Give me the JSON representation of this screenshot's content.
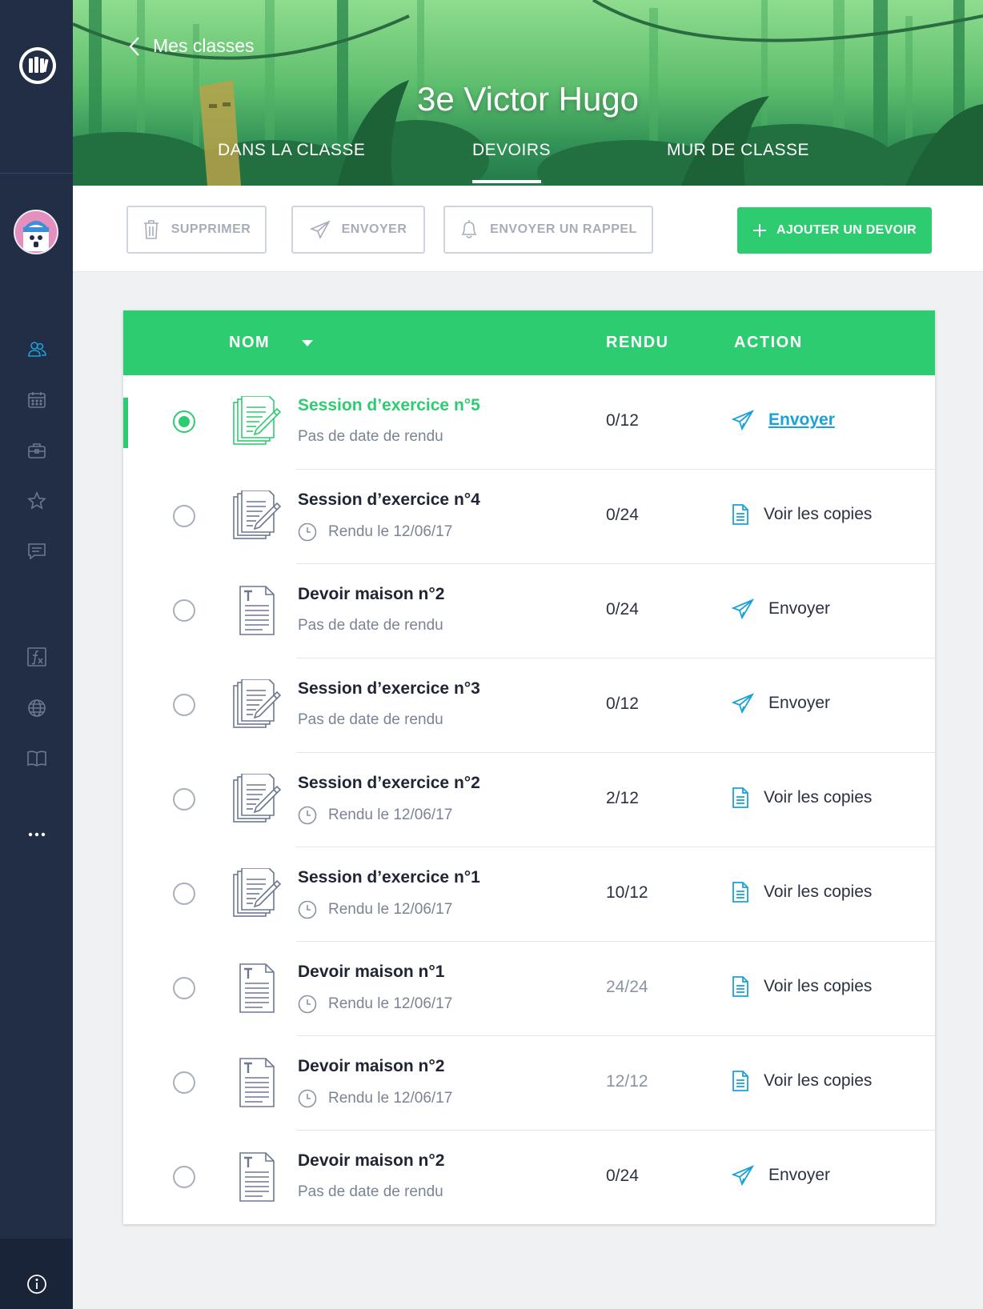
{
  "header": {
    "back_label": "Mes classes",
    "class_title": "3e Victor Hugo",
    "tabs": [
      {
        "label": "DANS LA CLASSE",
        "active": false
      },
      {
        "label": "DEVOIRS",
        "active": true
      },
      {
        "label": "MUR DE CLASSE",
        "active": false
      }
    ]
  },
  "toolbar": {
    "delete_label": "SUPPRIMER",
    "send_label": "ENVOYER",
    "reminder_label": "ENVOYER UN RAPPEL",
    "add_label": "AJOUTER UN DEVOIR"
  },
  "table": {
    "columns": {
      "name": "NOM",
      "rendu": "RENDU",
      "action": "ACTION"
    },
    "rows": [
      {
        "name": "Session d’exercice n°5",
        "sub": "Pas de date de rendu",
        "has_clock": false,
        "rendu": "0/12",
        "rendu_muted": false,
        "action": "Envoyer",
        "action_icon": "paper-plane-icon",
        "file_icon": "exercise-sheet-icon",
        "selected": true
      },
      {
        "name": "Session d’exercice n°4",
        "sub": "Rendu le 12/06/17",
        "has_clock": true,
        "rendu": "0/24",
        "rendu_muted": false,
        "action": "Voir les copies",
        "action_icon": "document-icon",
        "file_icon": "exercise-sheet-icon",
        "selected": false
      },
      {
        "name": "Devoir maison n°2",
        "sub": "Pas de date de rendu",
        "has_clock": false,
        "rendu": "0/24",
        "rendu_muted": false,
        "action": "Envoyer",
        "action_icon": "paper-plane-icon",
        "file_icon": "text-document-icon",
        "selected": false
      },
      {
        "name": "Session d’exercice n°3",
        "sub": "Pas de date de rendu",
        "has_clock": false,
        "rendu": "0/12",
        "rendu_muted": false,
        "action": "Envoyer",
        "action_icon": "paper-plane-icon",
        "file_icon": "exercise-sheet-icon",
        "selected": false
      },
      {
        "name": "Session d’exercice n°2",
        "sub": "Rendu le 12/06/17",
        "has_clock": true,
        "rendu": "2/12",
        "rendu_muted": false,
        "action": "Voir les copies",
        "action_icon": "document-icon",
        "file_icon": "exercise-sheet-icon",
        "selected": false
      },
      {
        "name": "Session d’exercice n°1",
        "sub": "Rendu le 12/06/17",
        "has_clock": true,
        "rendu": "10/12",
        "rendu_muted": false,
        "action": "Voir les copies",
        "action_icon": "document-icon",
        "file_icon": "exercise-sheet-icon",
        "selected": false
      },
      {
        "name": "Devoir maison n°1",
        "sub": "Rendu le 12/06/17",
        "has_clock": true,
        "rendu": "24/24",
        "rendu_muted": true,
        "action": "Voir les copies",
        "action_icon": "document-icon",
        "file_icon": "text-document-icon",
        "selected": false
      },
      {
        "name": "Devoir maison n°2",
        "sub": "Rendu le 12/06/17",
        "has_clock": true,
        "rendu": "12/12",
        "rendu_muted": true,
        "action": "Voir les copies",
        "action_icon": "document-icon",
        "file_icon": "text-document-icon",
        "selected": false
      },
      {
        "name": "Devoir maison n°2",
        "sub": "Pas de date de rendu",
        "has_clock": false,
        "rendu": "0/24",
        "rendu_muted": false,
        "action": "Envoyer",
        "action_icon": "paper-plane-icon",
        "file_icon": "text-document-icon",
        "selected": false
      }
    ]
  },
  "sidebar": {
    "nav_icons": [
      "users-icon",
      "calendar-icon",
      "briefcase-icon",
      "star-icon",
      "message-icon",
      "formula-icon",
      "globe-icon",
      "book-icon",
      "more-icon"
    ]
  },
  "colors": {
    "accent_green": "#2ecc71",
    "link_blue": "#1ba1d9",
    "sidebar_navy": "#222e45"
  }
}
